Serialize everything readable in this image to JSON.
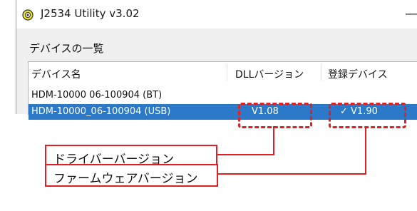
{
  "window": {
    "title": "J2534 Utility v3.02",
    "minimize_glyph": "—",
    "app_icon": "circle-eye-icon"
  },
  "device_list": {
    "label": "デバイスの一覧",
    "columns": [
      "デバイス名",
      "DLLバージョン",
      "登録デバイス"
    ],
    "rows": [
      {
        "name": "HDM-10000 06-100904 (BT)",
        "dll_version": "",
        "registered": ""
      },
      {
        "name": "HDM-10000_06-100904 (USB)",
        "dll_version": "V1.08",
        "registered": "✓ V1.90",
        "selected": true
      }
    ]
  },
  "callouts": {
    "driver_version": "ドライバーバージョン",
    "firmware_version": "ファームウェアバージョン"
  },
  "colors": {
    "selection": "#2b79c8",
    "annotation": "#e02020"
  }
}
